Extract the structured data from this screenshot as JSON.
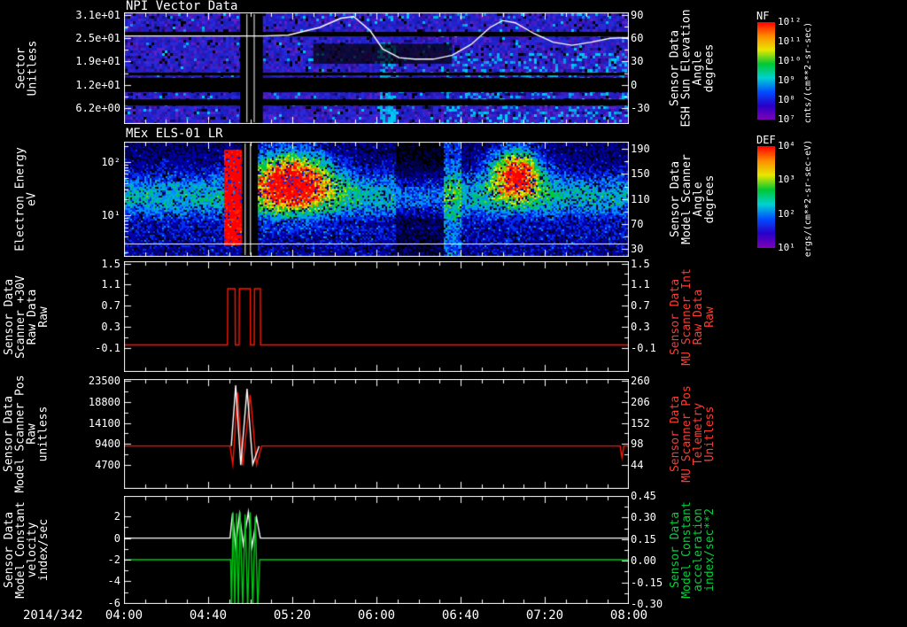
{
  "page": {
    "background": "#000000"
  },
  "xaxis": {
    "date_label": "2014/342",
    "tick_labels": [
      "04:00",
      "04:40",
      "05:20",
      "06:00",
      "06:40",
      "07:20",
      "08:00"
    ],
    "tick_hours": [
      4.0,
      4.6667,
      5.3333,
      6.0,
      6.6667,
      7.3333,
      8.0
    ],
    "range_hours": [
      4.0,
      8.0
    ],
    "minor_tick_minutes": 10
  },
  "colorbars": [
    {
      "title": "NF",
      "unit": "cnts/(cm**2-sr-sec)",
      "tick_labels": [
        "10¹²",
        "10¹¹",
        "10¹⁰",
        "10⁹",
        "10⁸",
        "10⁷"
      ],
      "gradient": [
        "#ff0000",
        "#ff8c00",
        "#e8e800",
        "#00c832",
        "#00d2d2",
        "#0050ff",
        "#2800c8",
        "#8000b4"
      ]
    },
    {
      "title": "DEF",
      "unit": "ergs/(cm**2-sr-sec-eV)",
      "tick_labels": [
        "10⁴",
        "10³",
        "10²",
        "10¹"
      ],
      "gradient": [
        "#ff0000",
        "#ff8c00",
        "#e8e800",
        "#00c832",
        "#00d2d2",
        "#0050ff",
        "#2800c8",
        "#8000b4"
      ]
    }
  ],
  "panels": [
    {
      "title": "NPI Vector Data",
      "left_label_lines": [
        "Sector",
        "Unitless"
      ],
      "left_tick_labels": [
        "3.1e+01",
        "2.5e+01",
        "1.9e+01",
        "1.2e+01",
        "6.2e+00"
      ],
      "right_label_lines": [
        "Sensor Data",
        "ESH Sun Elevation",
        "Angle",
        "degrees"
      ],
      "right_tick_labels": [
        "90",
        "60",
        "30",
        "0",
        "-30"
      ],
      "right_label_color": "#ffffff"
    },
    {
      "title": "MEx ELS-01 LR",
      "left_label_lines": [
        "Electron Energy",
        "eV"
      ],
      "left_tick_labels": [
        "10²",
        "10¹"
      ],
      "right_label_lines": [
        "Sensor Data",
        "Model Scanner",
        "Angle",
        "degrees"
      ],
      "right_tick_labels": [
        "190",
        "150",
        "110",
        "70",
        "30"
      ],
      "right_label_color": "#ffffff"
    },
    {
      "title": "",
      "left_label_lines": [
        "Sensor Data",
        "Scanner +30V",
        "Raw Data",
        "Raw"
      ],
      "left_tick_labels": [
        "1.5",
        "1.1",
        "0.7",
        "0.3",
        "-0.1"
      ],
      "right_label_lines": [
        "Sensor Data",
        "MU Scanner Int",
        "Raw Data",
        "Raw"
      ],
      "right_tick_labels": [
        "1.5",
        "1.1",
        "0.7",
        "0.3",
        "-0.1"
      ],
      "right_label_color": "#ff3b30"
    },
    {
      "title": "",
      "left_label_lines": [
        "Sensor Data",
        "Model Scanner Pos",
        "Raw",
        "unitless"
      ],
      "left_tick_labels": [
        "23500",
        "18800",
        "14100",
        "9400",
        "4700"
      ],
      "right_label_lines": [
        "Sensor Data",
        "MU Scanner Pos",
        "Telemetry",
        "Unitless"
      ],
      "right_tick_labels": [
        "260",
        "206",
        "152",
        "98",
        "44"
      ],
      "right_label_color": "#ff3b30"
    },
    {
      "title": "",
      "left_label_lines": [
        "Sensor Data",
        "Model Constant",
        "velocity",
        "index/sec"
      ],
      "left_tick_labels": [
        "2",
        "0",
        "-2",
        "-4",
        "-6"
      ],
      "right_label_lines": [
        "Sensor Data",
        "Model Constant",
        "acceleration",
        "index/sec**2"
      ],
      "right_tick_labels": [
        "0.45",
        "0.30",
        "0.15",
        "0.00",
        "-0.15",
        "-0.30"
      ],
      "right_label_color": "#00d23c"
    }
  ],
  "chart_data": [
    {
      "type": "heatmap",
      "panel": "NPI Vector Data",
      "x_hours": [
        4.0,
        8.0
      ],
      "y_label": "Sector (unitless)",
      "y_ticks": [
        31,
        25,
        19,
        12,
        6.2
      ],
      "value_label": "NF cnts/(cm**2-sr-sec)",
      "value_range_log10": [
        7,
        12
      ],
      "left_tick_fracs": [
        0.024,
        0.232,
        0.44,
        0.649,
        0.857
      ],
      "right_tick_fracs": [
        0.024,
        0.232,
        0.44,
        0.649,
        0.857
      ],
      "black_band_fracs": [
        [
          0.175,
          0.215
        ],
        [
          0.54,
          0.565
        ],
        [
          0.585,
          0.715
        ],
        [
          0.78,
          0.835
        ]
      ],
      "dark_patch": [
        5.5,
        6.6,
        0.28,
        0.46
      ],
      "gap_hours": [
        4.92,
        5.1
      ],
      "overlay_series": {
        "name": "ESH Sun Elevation Angle",
        "units": "degrees",
        "color": "#ffffff",
        "y_map": {
          "v_top": 90,
          "v_step": 30,
          "f_top": 0.024,
          "f_step": 0.208
        },
        "points": [
          [
            4.0,
            63
          ],
          [
            4.5,
            63
          ],
          [
            4.92,
            63
          ],
          [
            5.1,
            63
          ],
          [
            5.3,
            64
          ],
          [
            5.55,
            74
          ],
          [
            5.72,
            86
          ],
          [
            5.82,
            88
          ],
          [
            5.95,
            70
          ],
          [
            6.05,
            46
          ],
          [
            6.18,
            35
          ],
          [
            6.3,
            33
          ],
          [
            6.45,
            33
          ],
          [
            6.6,
            38
          ],
          [
            6.75,
            52
          ],
          [
            6.9,
            74
          ],
          [
            7.0,
            83
          ],
          [
            7.1,
            80
          ],
          [
            7.25,
            66
          ],
          [
            7.4,
            55
          ],
          [
            7.55,
            51
          ],
          [
            7.7,
            55
          ],
          [
            7.85,
            60
          ],
          [
            8.0,
            61
          ]
        ]
      }
    },
    {
      "type": "heatmap",
      "panel": "MEx ELS-01 LR",
      "x_hours": [
        4.0,
        8.0
      ],
      "y_label": "Electron Energy (eV)",
      "y_scale": "log",
      "y_ticks": [
        100,
        10
      ],
      "value_label": "DEF ergs/(cm**2-sr-sec-eV)",
      "value_range_log10": [
        1,
        4
      ],
      "left_tick_fracs": [
        0.177,
        0.64
      ],
      "left_minor_fracs": [
        0.038,
        0.198,
        0.222,
        0.249,
        0.28,
        0.316,
        0.361,
        0.419,
        0.5,
        0.661,
        0.685,
        0.712,
        0.743,
        0.779,
        0.824,
        0.882,
        0.964
      ],
      "right_tick_fracs": [
        0.06,
        0.277,
        0.5,
        0.715,
        0.93
      ],
      "gap_hours": [
        4.93,
        5.05
      ],
      "hot_regions_hours": [
        [
          4.78,
          4.93
        ],
        [
          5.05,
          5.65
        ],
        [
          6.95,
          7.3
        ]
      ],
      "overlay_line_frac": 0.885
    },
    {
      "type": "line",
      "panel": "Scanner +30V",
      "y_map": {
        "v_top": 1.5,
        "v_step": 0.4,
        "f_top": 0.02,
        "f_step": 0.19
      },
      "left_tick_fracs": [
        0.02,
        0.21,
        0.4,
        0.59,
        0.78
      ],
      "right_tick_fracs": [
        0.02,
        0.21,
        0.4,
        0.59,
        0.78
      ],
      "series": [
        {
          "name": "MU Scanner Int Raw Data",
          "color": "#ff1500",
          "points": [
            [
              4.0,
              -0.05
            ],
            [
              4.82,
              -0.05
            ],
            [
              4.822,
              1.02
            ],
            [
              4.88,
              1.02
            ],
            [
              4.882,
              -0.05
            ],
            [
              4.912,
              -0.05
            ],
            [
              4.914,
              1.02
            ],
            [
              5.0,
              1.02
            ],
            [
              5.002,
              -0.05
            ],
            [
              5.032,
              -0.05
            ],
            [
              5.034,
              1.02
            ],
            [
              5.08,
              1.02
            ],
            [
              5.082,
              -0.05
            ],
            [
              8.0,
              -0.05
            ]
          ]
        }
      ]
    },
    {
      "type": "line",
      "panel": "Model Scanner Pos",
      "y_map": {
        "v_top": 23500,
        "v_step": 4700,
        "f_top": 0.02,
        "f_step": 0.19
      },
      "left_tick_fracs": [
        0.02,
        0.21,
        0.4,
        0.59,
        0.78
      ],
      "right_tick_fracs": [
        0.02,
        0.21,
        0.4,
        0.59,
        0.78
      ],
      "series": [
        {
          "name": "MU Scanner Pos Telemetry",
          "color": "#ff1500",
          "points": [
            [
              4.0,
              8900
            ],
            [
              4.84,
              8900
            ],
            [
              4.862,
              4700
            ],
            [
              4.9,
              21000
            ],
            [
              4.94,
              4500
            ],
            [
              5.0,
              20400
            ],
            [
              5.05,
              4700
            ],
            [
              5.09,
              8900
            ],
            [
              7.93,
              8900
            ],
            [
              7.945,
              6300
            ],
            [
              7.96,
              8900
            ],
            [
              8.0,
              8900
            ]
          ]
        },
        {
          "name": "Model Scanner Pos Raw",
          "color": "#ffffff",
          "points": [
            [
              4.85,
              8900
            ],
            [
              4.885,
              22600
            ],
            [
              4.925,
              4600
            ],
            [
              4.975,
              21800
            ],
            [
              5.02,
              4800
            ],
            [
              5.07,
              8900
            ]
          ]
        }
      ]
    },
    {
      "type": "line",
      "panel": "Model Constant",
      "y_map": {
        "v_top": 2,
        "v_step": 2,
        "f_top": 0.19,
        "f_step": 0.2
      },
      "left_tick_fracs": [
        0.19,
        0.39,
        0.59,
        0.79,
        0.99
      ],
      "right_tick_fracs": [
        0.0,
        0.2,
        0.4,
        0.6,
        0.8,
        1.0
      ],
      "series": [
        {
          "name": "Model Constant velocity (index/sec)",
          "color": "#ffffff",
          "points": [
            [
              4.0,
              0
            ],
            [
              4.84,
              0
            ],
            [
              4.86,
              2.3
            ],
            [
              4.885,
              -0.9
            ],
            [
              4.915,
              2.2
            ],
            [
              4.945,
              -0.6
            ],
            [
              4.985,
              2.4
            ],
            [
              5.015,
              -0.8
            ],
            [
              5.05,
              1.9
            ],
            [
              5.08,
              0
            ],
            [
              8.0,
              0
            ]
          ]
        },
        {
          "name": "Model Constant acceleration (index/sec**2)",
          "color": "#00c814",
          "points": [
            [
              4.0,
              -2
            ],
            [
              4.845,
              -2
            ],
            [
              4.852,
              -6.6
            ],
            [
              4.864,
              2.4
            ],
            [
              4.878,
              -6.4
            ],
            [
              4.892,
              2.3
            ],
            [
              4.906,
              -6.5
            ],
            [
              4.92,
              2.4
            ],
            [
              4.94,
              -6.3
            ],
            [
              4.96,
              2.2
            ],
            [
              4.98,
              -6.5
            ],
            [
              5.0,
              2.4
            ],
            [
              5.02,
              -6.4
            ],
            [
              5.04,
              2.0
            ],
            [
              5.06,
              -6.5
            ],
            [
              5.075,
              -2
            ],
            [
              8.0,
              -2
            ]
          ]
        }
      ]
    }
  ]
}
